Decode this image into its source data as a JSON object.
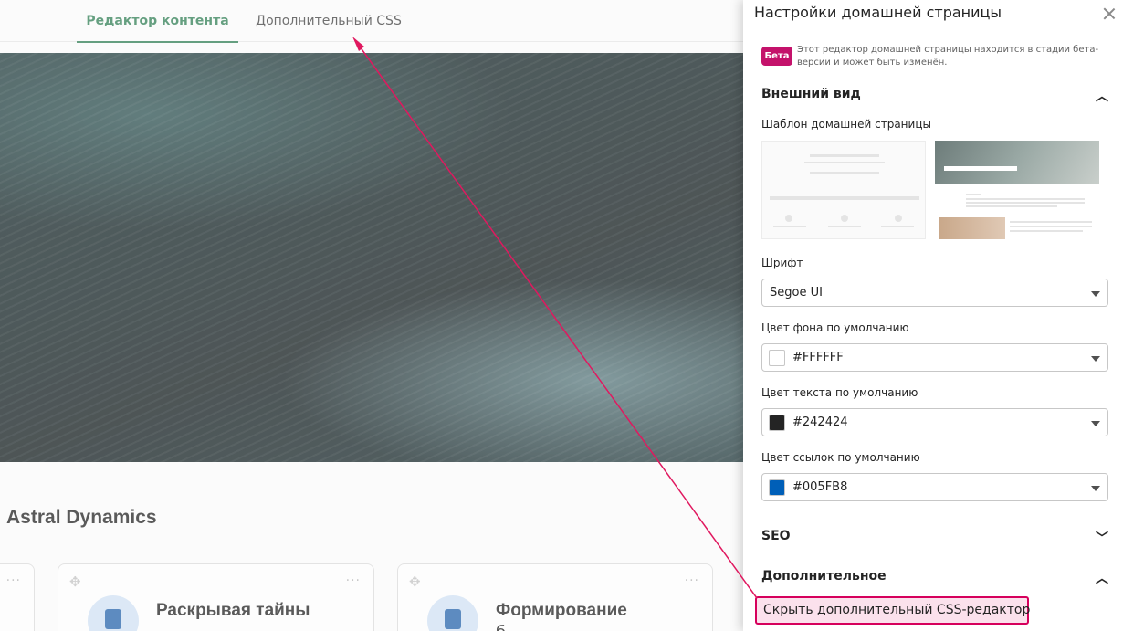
{
  "tabs": {
    "content_editor": "Редактор контента",
    "additional_css": "Дополнительный CSS"
  },
  "site": {
    "title": "Astral Dynamics"
  },
  "cards": [
    {
      "title": "",
      "subtitle": ""
    },
    {
      "title": "Раскрывая тайны",
      "subtitle": ""
    },
    {
      "title": "Формирование",
      "subtitle": "б"
    }
  ],
  "panel": {
    "title": "Настройки домашней страницы",
    "beta_badge": "Бета",
    "beta_note": "Этот редактор домашней страницы находится в стадии бета-версии и может быть изменён.",
    "sections": {
      "appearance": "Внешний вид",
      "seo": "SEO",
      "advanced": "Дополнительное"
    },
    "template_label": "Шаблон домашней страницы",
    "font": {
      "label": "Шрифт",
      "value": "Segoe UI"
    },
    "background_color": {
      "label": "Цвет фона по умолчанию",
      "value": "#FFFFFF",
      "swatch": "#FFFFFF"
    },
    "text_color": {
      "label": "Цвет текста по умолчанию",
      "value": "#242424",
      "swatch": "#242424"
    },
    "link_color": {
      "label": "Цвет ссылок по умолчанию",
      "value": "#005FB8",
      "swatch": "#005FB8"
    },
    "hide_css_button": "Скрыть дополнительный CSS-редактор"
  },
  "colors": {
    "accent_green": "#2a7a4f",
    "beta_badge": "#c4126b",
    "annotation": "#e0185f"
  },
  "icons": {
    "close": "close-icon",
    "chevron_up": "chevron-up-icon",
    "chevron_down": "chevron-down-icon",
    "more": "more-icon",
    "move": "move-icon",
    "book": "book-icon"
  }
}
